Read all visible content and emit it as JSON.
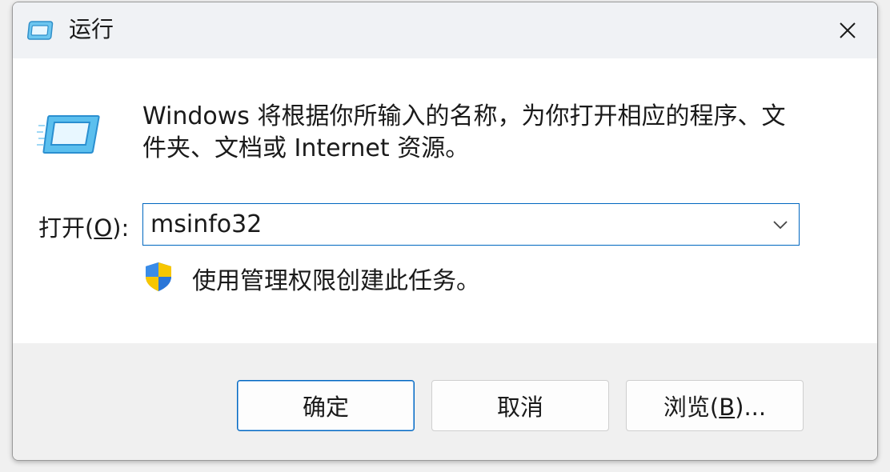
{
  "window": {
    "title": "运行"
  },
  "content": {
    "description": "Windows 将根据你所输入的名称，为你打开相应的程序、文件夹、文档或 Internet 资源。",
    "open_label_prefix": "打开(",
    "open_label_mnemonic": "O",
    "open_label_suffix": "):",
    "open_input_value": "msinfo32",
    "admin_notice": "使用管理权限创建此任务。"
  },
  "buttons": {
    "ok_label": "确定",
    "cancel_label": "取消",
    "browse_label_prefix": "浏览(",
    "browse_label_mnemonic": "B",
    "browse_label_suffix": ")..."
  },
  "icons": {
    "title_icon": "run-icon",
    "dialog_icon": "run-icon",
    "close_icon": "close-icon",
    "dropdown_icon": "chevron-down-icon",
    "shield_icon": "uac-shield-icon"
  },
  "colors": {
    "accent": "#0067c0",
    "content_bg": "#ffffff",
    "footer_bg": "#f0f0f0"
  }
}
